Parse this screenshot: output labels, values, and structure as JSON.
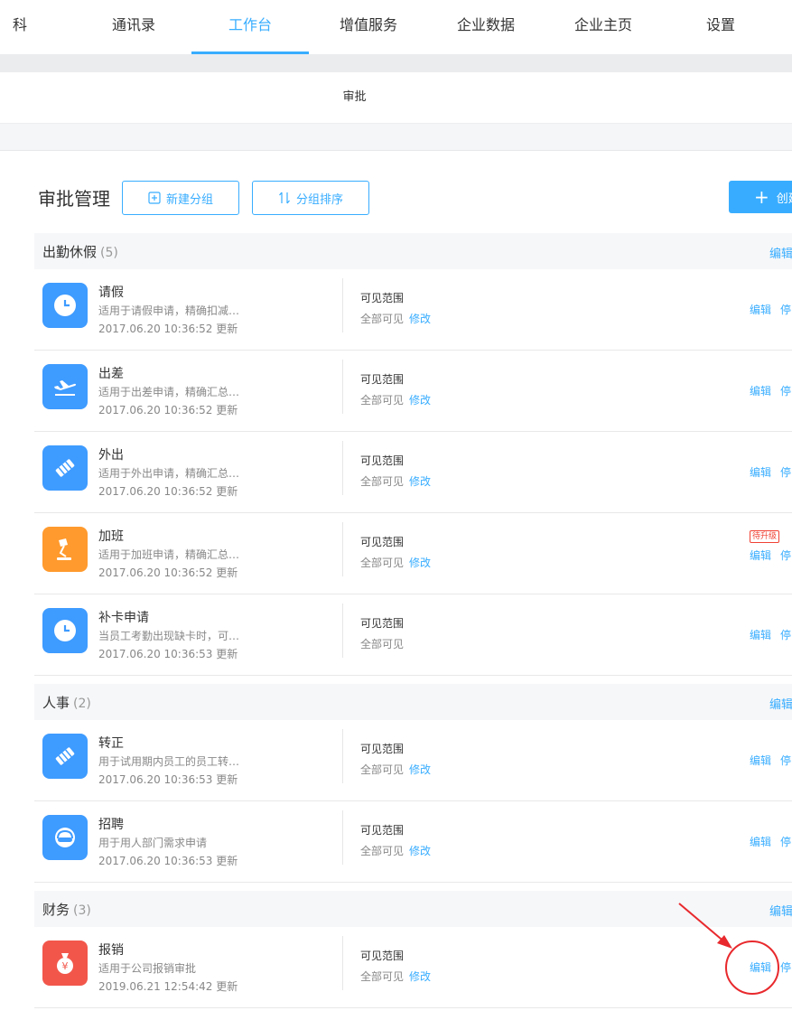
{
  "nav": {
    "items": [
      "科技…",
      "通讯录",
      "工作台",
      "增值服务",
      "企业数据",
      "企业主页",
      "设置"
    ],
    "active_index": 2
  },
  "subbar": {
    "title": "审批"
  },
  "header": {
    "title": "审批管理",
    "new_group_label": "新建分组",
    "sort_group_label": "分组排序",
    "create_label": "创建"
  },
  "groups": [
    {
      "name": "出勤休假",
      "count": "(5)",
      "edit_label": "编辑"
    },
    {
      "name": "人事",
      "count": "(2)",
      "edit_label": "编辑"
    },
    {
      "name": "财务",
      "count": "(3)",
      "edit_label": "编辑"
    }
  ],
  "rows": [
    {
      "name": "请假",
      "desc": "适用于请假申请，精确扣减…",
      "time": "2017.06.20 10:36:52 更新",
      "vis_label": "可见范围",
      "vis_value": "全部可见",
      "modify": "修改",
      "edit": "编辑",
      "stop": "停",
      "icon": "clock-icon",
      "color": "#3e9bff"
    },
    {
      "name": "出差",
      "desc": "适用于出差申请，精确汇总…",
      "time": "2017.06.20 10:36:52 更新",
      "vis_label": "可见范围",
      "vis_value": "全部可见",
      "modify": "修改",
      "edit": "编辑",
      "stop": "停",
      "icon": "airplane-icon",
      "color": "#3e9bff"
    },
    {
      "name": "外出",
      "desc": "适用于外出申请，精确汇总…",
      "time": "2017.06.20 10:36:52 更新",
      "vis_label": "可见范围",
      "vis_value": "全部可见",
      "modify": "修改",
      "edit": "编辑",
      "stop": "停",
      "icon": "handshake-icon",
      "color": "#3e9bff"
    },
    {
      "name": "加班",
      "desc": "适用于加班申请，精确汇总…",
      "time": "2017.06.20 10:36:52 更新",
      "vis_label": "可见范围",
      "vis_value": "全部可见",
      "modify": "修改",
      "edit": "编辑",
      "stop": "停",
      "badge": "待升级",
      "icon": "desk-lamp-icon",
      "color": "#ff9a2e"
    },
    {
      "name": "补卡申请",
      "desc": "当员工考勤出现缺卡时，可…",
      "time": "2017.06.20 10:36:53 更新",
      "vis_label": "可见范围",
      "vis_value": "全部可见",
      "modify": "",
      "edit": "编辑",
      "stop": "停",
      "icon": "clock-icon",
      "color": "#3e9bff"
    },
    {
      "name": "转正",
      "desc": "用于试用期内员工的员工转…",
      "time": "2017.06.20 10:36:53 更新",
      "vis_label": "可见范围",
      "vis_value": "全部可见",
      "modify": "修改",
      "edit": "编辑",
      "stop": "停",
      "icon": "handshake-icon",
      "color": "#3e9bff"
    },
    {
      "name": "招聘",
      "desc": "用于用人部门需求申请",
      "time": "2017.06.20 10:36:53 更新",
      "vis_label": "可见范围",
      "vis_value": "全部可见",
      "modify": "修改",
      "edit": "编辑",
      "stop": "停",
      "icon": "headset-icon",
      "color": "#3e9bff"
    },
    {
      "name": "报销",
      "desc": "适用于公司报销审批",
      "time": "2019.06.21 12:54:42 更新",
      "vis_label": "可见范围",
      "vis_value": "全部可见",
      "modify": "修改",
      "edit": "编辑",
      "stop": "停",
      "icon": "money-bag-icon",
      "color": "#f2564a"
    }
  ],
  "colors": {
    "accent": "#38adff",
    "icon_blue": "#3e9bff",
    "icon_orange": "#ff9a2e",
    "icon_red": "#f2564a",
    "annotation": "#e8292d"
  }
}
